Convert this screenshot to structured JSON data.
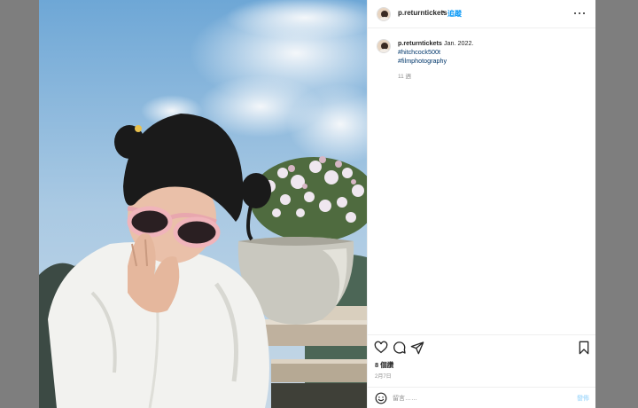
{
  "post": {
    "username": "p.returntickets",
    "separator": "•",
    "follow_label": "追蹤",
    "caption": {
      "username": "p.returntickets",
      "text": "Jan. 2022.",
      "hashtags": [
        "#hitchcock500t",
        "#filmphotography"
      ],
      "time_ago": "11 週"
    },
    "likes_label": "8 個讚",
    "date_label": "2月7日",
    "comment": {
      "placeholder": "留言……",
      "post_label": "發佈"
    },
    "icons": {
      "more": "more-options-icon",
      "like": "heart-icon",
      "comment": "comment-bubble-icon",
      "share": "paper-plane-icon",
      "save": "bookmark-icon",
      "emoji": "smiley-icon"
    },
    "colors": {
      "link_blue": "#0095f6",
      "hashtag": "#00376b",
      "muted": "#8e8e8e",
      "text": "#262626",
      "post_disabled": "#b2dffc"
    }
  }
}
